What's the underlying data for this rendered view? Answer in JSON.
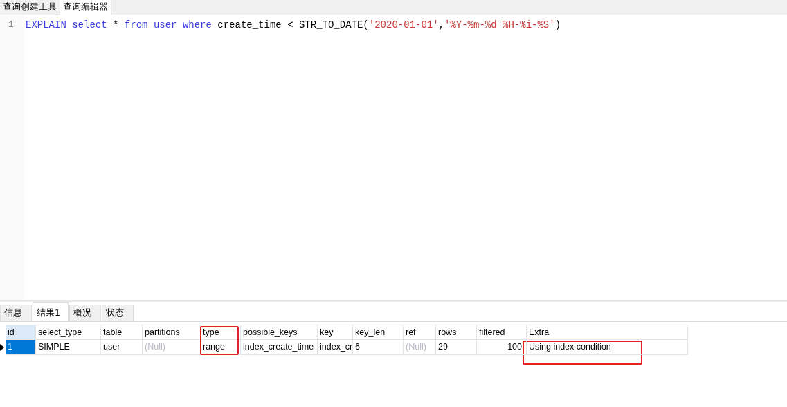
{
  "top_tabs": [
    {
      "label": "查询创建工具",
      "selected": false
    },
    {
      "label": "查询编辑器",
      "selected": true
    }
  ],
  "editor": {
    "lines": [
      {
        "number": "1",
        "tokens": [
          {
            "kind": "keyword",
            "text": "EXPLAIN"
          },
          {
            "kind": "keyword",
            "text": "select"
          },
          {
            "kind": "plain",
            "text": "*"
          },
          {
            "kind": "keyword",
            "text": "from"
          },
          {
            "kind": "keyword",
            "text": "user"
          },
          {
            "kind": "keyword",
            "text": "where"
          },
          {
            "kind": "plain",
            "text": "create_time"
          },
          {
            "kind": "plain",
            "text": "<"
          },
          {
            "kind": "plain",
            "text": "STR_TO_DATE("
          },
          {
            "kind": "string",
            "text": "'2020-01-01'"
          },
          {
            "kind": "plain",
            "text": ","
          },
          {
            "kind": "string",
            "text": "'%Y-%m-%d %H-%i-%S'"
          },
          {
            "kind": "plain",
            "text": ")"
          }
        ]
      }
    ]
  },
  "result_tabs": [
    {
      "label": "信息",
      "selected": false
    },
    {
      "label": "结果1",
      "selected": true
    },
    {
      "label": "概况",
      "selected": false
    },
    {
      "label": "状态",
      "selected": false
    }
  ],
  "table": {
    "columns": [
      {
        "label": "id",
        "highlighted": false
      },
      {
        "label": "select_type",
        "highlighted": false
      },
      {
        "label": "table",
        "highlighted": false
      },
      {
        "label": "partitions",
        "highlighted": false
      },
      {
        "label": "type",
        "highlighted": true
      },
      {
        "label": "possible_keys",
        "highlighted": false
      },
      {
        "label": "key",
        "highlighted": false
      },
      {
        "label": "key_len",
        "highlighted": false
      },
      {
        "label": "ref",
        "highlighted": false
      },
      {
        "label": "rows",
        "highlighted": false
      },
      {
        "label": "filtered",
        "highlighted": false
      },
      {
        "label": "Extra",
        "highlighted": false
      }
    ],
    "rows": [
      {
        "selected": true,
        "cells": [
          {
            "text": "1",
            "null": false
          },
          {
            "text": "SIMPLE",
            "null": false
          },
          {
            "text": "user",
            "null": false
          },
          {
            "text": "(Null)",
            "null": true
          },
          {
            "text": "range",
            "null": false
          },
          {
            "text": "index_create_time",
            "null": false
          },
          {
            "text": "index_cr",
            "null": false
          },
          {
            "text": "6",
            "null": false
          },
          {
            "text": "(Null)",
            "null": true
          },
          {
            "text": "29",
            "null": false
          },
          {
            "text": "100",
            "null": false,
            "right_aligned": true
          },
          {
            "text": "Using index condition",
            "null": false,
            "highlighted": true
          }
        ]
      }
    ]
  }
}
